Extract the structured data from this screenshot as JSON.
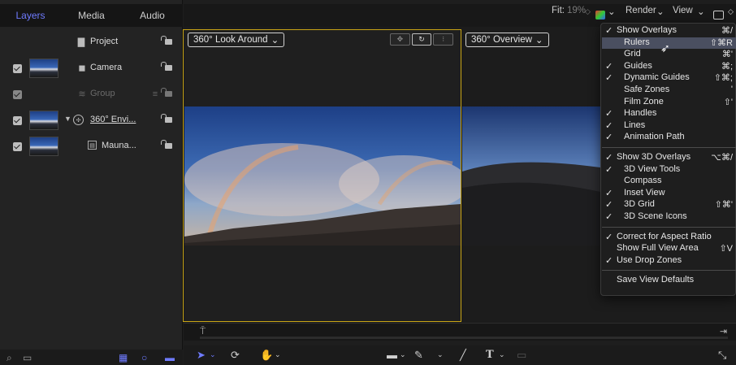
{
  "left_panel": {
    "tabs": [
      {
        "label": "Layers",
        "active": true
      },
      {
        "label": "Media",
        "active": false
      },
      {
        "label": "Audio",
        "active": false
      }
    ],
    "layers": [
      {
        "name": "Project",
        "icon": "document-icon",
        "checkbox": false,
        "thumbnail": false,
        "dim": false
      },
      {
        "name": "Camera",
        "icon": "camera-icon",
        "checkbox": true,
        "thumbnail": true,
        "dim": false
      },
      {
        "name": "Group",
        "icon": "group-icon",
        "checkbox": true,
        "thumbnail": false,
        "dim": true
      },
      {
        "name": "360° Envi...",
        "icon": "360-environment-icon",
        "checkbox": true,
        "thumbnail": true,
        "dim": false,
        "disclosure": "▼"
      },
      {
        "name": "Mauna...",
        "icon": "film-strip-icon",
        "checkbox": true,
        "thumbnail": true,
        "dim": false
      }
    ]
  },
  "top_toolbar": {
    "fit_label": "Fit:",
    "zoom": "19%",
    "zoom_suffix": "◇",
    "render_label": "Render",
    "view_label": "View",
    "chevron": "⌄",
    "layout_chevron": "◇"
  },
  "viewports": {
    "left": {
      "label": "360° Look Around",
      "chevron": "⌄"
    },
    "right": {
      "label": "360° Overview",
      "chevron": "⌄"
    },
    "controls": [
      "✥",
      "↻",
      "⁝"
    ]
  },
  "overlay_menu": {
    "items": [
      {
        "label": "Show Overlays",
        "checked": true,
        "indent": false,
        "shortcut": "⌘/"
      },
      {
        "label": "Rulers",
        "checked": false,
        "indent": true,
        "shortcut": "⇧⌘R",
        "highlighted": true
      },
      {
        "label": "Grid",
        "checked": false,
        "indent": true,
        "shortcut": "⌘'"
      },
      {
        "label": "Guides",
        "checked": true,
        "indent": true,
        "shortcut": "⌘;"
      },
      {
        "label": "Dynamic Guides",
        "checked": true,
        "indent": true,
        "shortcut": "⇧⌘;"
      },
      {
        "label": "Safe Zones",
        "checked": false,
        "indent": true,
        "shortcut": "'"
      },
      {
        "label": "Film Zone",
        "checked": false,
        "indent": true,
        "shortcut": "⇧'"
      },
      {
        "label": "Handles",
        "checked": true,
        "indent": true,
        "shortcut": ""
      },
      {
        "label": "Lines",
        "checked": true,
        "indent": true,
        "shortcut": ""
      },
      {
        "label": "Animation Path",
        "checked": true,
        "indent": true,
        "shortcut": ""
      },
      {
        "separator": true
      },
      {
        "label": "Show 3D Overlays",
        "checked": true,
        "indent": false,
        "shortcut": "⌥⌘/"
      },
      {
        "label": "3D View Tools",
        "checked": true,
        "indent": true,
        "shortcut": ""
      },
      {
        "label": "Compass",
        "checked": false,
        "indent": true,
        "shortcut": ""
      },
      {
        "label": "Inset View",
        "checked": true,
        "indent": true,
        "shortcut": ""
      },
      {
        "label": "3D Grid",
        "checked": true,
        "indent": true,
        "shortcut": "⇧⌘'"
      },
      {
        "label": "3D Scene Icons",
        "checked": true,
        "indent": true,
        "shortcut": ""
      },
      {
        "separator": true
      },
      {
        "label": "Correct for Aspect Ratio",
        "checked": true,
        "indent": false,
        "shortcut": ""
      },
      {
        "label": "Show Full View Area",
        "checked": false,
        "indent": false,
        "shortcut": "⇧V"
      },
      {
        "label": "Use Drop Zones",
        "checked": true,
        "indent": false,
        "shortcut": ""
      },
      {
        "separator": true
      },
      {
        "label": "Save View Defaults",
        "checked": false,
        "indent": false,
        "shortcut": ""
      }
    ]
  },
  "bottom_toolbar": {
    "tools": [
      "select-arrow-icon",
      "orbit-icon",
      "hand-icon",
      "shape-rect-icon",
      "pen-icon",
      "paint-stroke-icon",
      "text-icon",
      "mask-icon",
      "expand-icon"
    ]
  },
  "left_footer": {
    "icons": [
      "search-icon",
      "layers-panel-icon",
      "checker-icon",
      "circle-icon",
      "stack-icon"
    ]
  },
  "colors": {
    "accent": "#6f7bff",
    "viewport_border": "#c9a515",
    "menu_highlight": "#4a4f60"
  }
}
